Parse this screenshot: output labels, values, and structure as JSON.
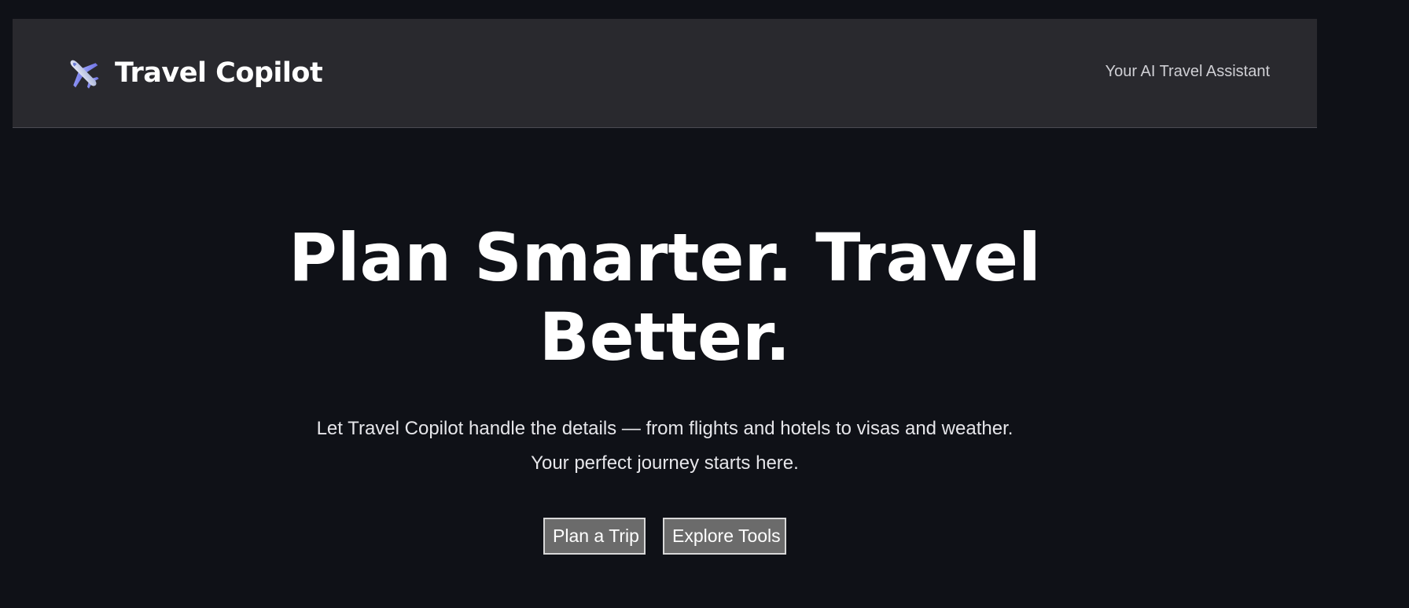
{
  "header": {
    "brand_icon": "airplane-icon",
    "brand_name": "Travel Copilot",
    "tagline": "Your AI Travel Assistant"
  },
  "hero": {
    "title": "Plan Smarter. Travel Better.",
    "subtitle": "Let Travel Copilot handle the details — from flights and hotels to visas and weather. Your perfect journey starts here.",
    "buttons": [
      {
        "label": "Plan a Trip"
      },
      {
        "label": "Explore Tools"
      }
    ]
  },
  "colors": {
    "background": "#0f1117",
    "header_background": "#29292e",
    "button_background": "#6b6b6b"
  }
}
